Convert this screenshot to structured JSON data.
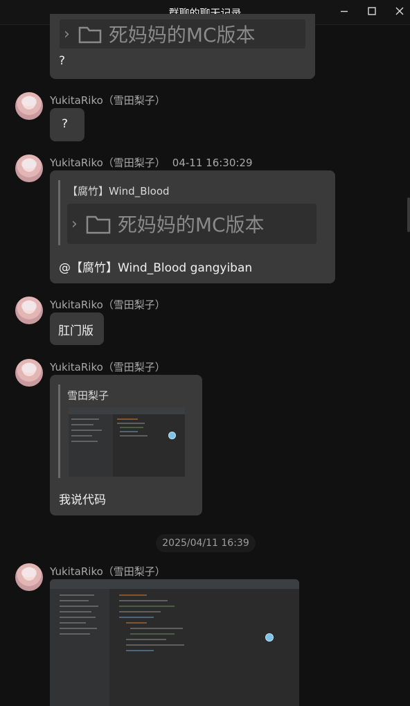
{
  "window": {
    "title": "群聊的聊天记录",
    "controls": [
      "minimize",
      "maximize",
      "close"
    ]
  },
  "messages": [
    {
      "id": "m0",
      "quote_card_text": "死妈妈的MC版本",
      "text": "?"
    },
    {
      "id": "m1",
      "sender": "YukitaRiko（雪田梨子）",
      "text": "?"
    },
    {
      "id": "m2",
      "sender": "YukitaRiko（雪田梨子）",
      "time": "04-11 16:30:29",
      "quote_author": "【腐竹】Wind_Blood",
      "quote_card_text": "死妈妈的MC版本",
      "text": "@【腐竹】Wind_Blood gangyiban"
    },
    {
      "id": "m3",
      "sender": "YukitaRiko（雪田梨子）",
      "text": "肛门版"
    },
    {
      "id": "m4",
      "sender": "YukitaRiko（雪田梨子）",
      "quote_author": "雪田梨子",
      "quote_image": "ide-screenshot-thumbnail",
      "text": "我说代码"
    }
  ],
  "timestamp_divider": "2025/04/11 16:39",
  "last_message": {
    "sender": "YukitaRiko（雪田梨子）",
    "image": "ide-screenshot"
  },
  "colors": {
    "background": "#111111",
    "bubble": "#3a3a3a",
    "card": "#2f2f2f",
    "sender_text": "#a9a9a9"
  },
  "icons": [
    "minimize-icon",
    "maximize-icon",
    "close-icon",
    "chevron-right-icon",
    "folder-icon",
    "avatar"
  ]
}
